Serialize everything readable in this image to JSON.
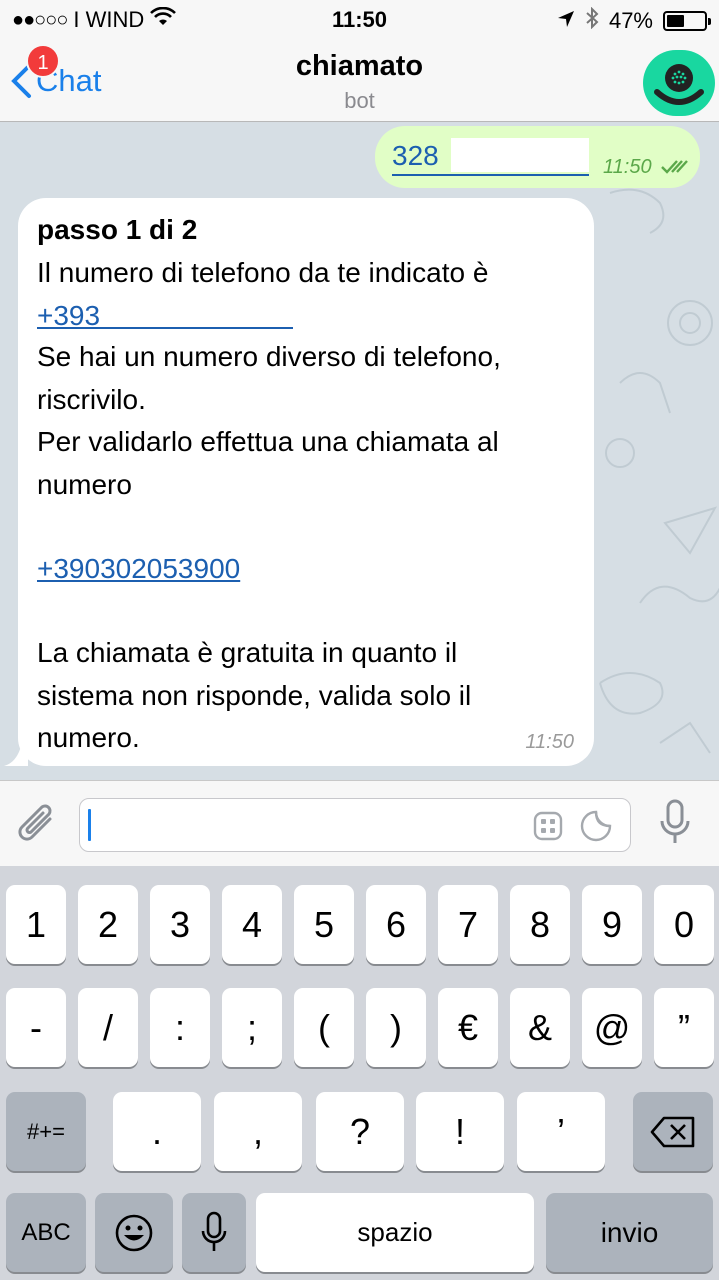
{
  "status_bar": {
    "signal_dots": "●●○○○",
    "carrier": "I WIND",
    "time": "11:50",
    "battery": "47%",
    "battery_level": 0.47
  },
  "nav": {
    "back_label": "Chat",
    "badge": "1",
    "title": "chiamato",
    "subtitle": "bot"
  },
  "messages": {
    "outgoing": {
      "text": "328",
      "time": "11:50"
    },
    "incoming": {
      "step": "passo 1 di 2",
      "line1": "Il numero di telefono da te indicato è",
      "phone": "+393",
      "line2": "Se hai un numero diverso di telefono,",
      "line3": "riscrivilo.",
      "line4": "Per validarlo effettua una chiamata al",
      "line5": "numero",
      "call_number": "+390302053900",
      "line6": "La chiamata è gratuita in quanto il",
      "line7": "sistema non risponde, valida solo il",
      "line8": "numero.",
      "time": "11:50"
    }
  },
  "keyboard": {
    "row1": [
      "1",
      "2",
      "3",
      "4",
      "5",
      "6",
      "7",
      "8",
      "9",
      "0"
    ],
    "row2": [
      "-",
      "/",
      ":",
      ";",
      "(",
      ")",
      "€",
      "&",
      "@",
      "”"
    ],
    "row3_left": "#+=",
    "row3": [
      ".",
      ",",
      "?",
      "!",
      "’"
    ],
    "abc": "ABC",
    "space": "spazio",
    "return": "invio"
  }
}
